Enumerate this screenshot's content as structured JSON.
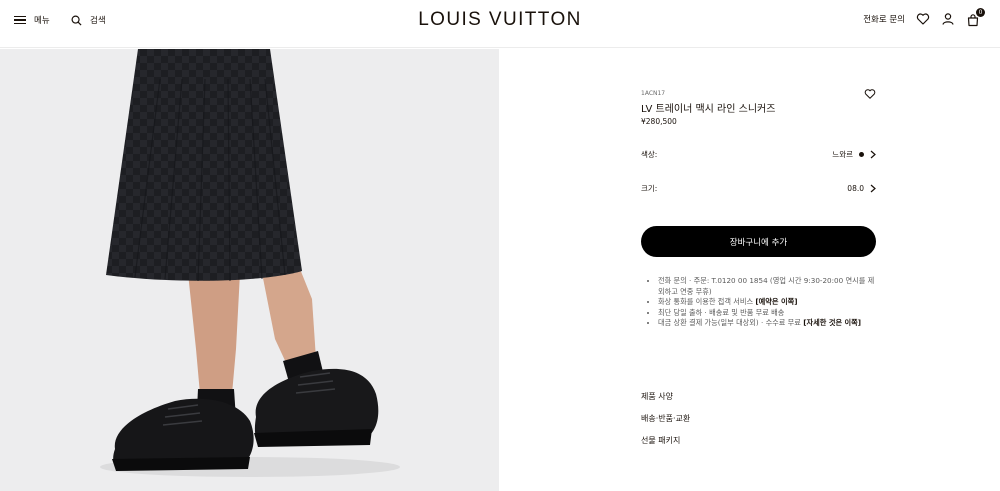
{
  "header": {
    "menu_label": "메뉴",
    "search_label": "검색",
    "logo": "LOUIS VUITTON",
    "contact_label": "전화로 문의",
    "cart_count": "0"
  },
  "product": {
    "sku": "1ACN17",
    "name": "LV 트레이너 맥시 라인 스니커즈",
    "price": "¥280,500",
    "color_label": "색상:",
    "color_value": "느와르",
    "size_label": "크기:",
    "size_value": "08.0",
    "add_to_cart": "장바구니에 추가"
  },
  "info": {
    "line1_text": "전화 문의 · 주문: T.0120 00 1854 (영업 시간 9:30-20:00 연시를 제외하고 연중 무휴)",
    "line2_text": "화상 통화를 이용한 접객 서비스 ",
    "line2_link": "[예약은 이쪽]",
    "line3_text": "최단 당일 출하 · 배송료 및 반품 무료 배송",
    "line4_text": "대금 상환 결제 가능(일부 대상외) · 수수료 무료 ",
    "line4_link": "[자세한 것은 이쪽]"
  },
  "accordion": {
    "item1": "제품 사양",
    "item2": "배송·반품·교환",
    "item3": "선물 패키지"
  },
  "colors": {
    "text": "#19110b",
    "button_bg": "#000000",
    "image_bg": "#ededee",
    "muted": "#5b5b5b"
  },
  "icons": [
    "menu-icon",
    "search-icon",
    "heart-icon",
    "user-icon",
    "cart-icon",
    "chevron-right-icon"
  ]
}
